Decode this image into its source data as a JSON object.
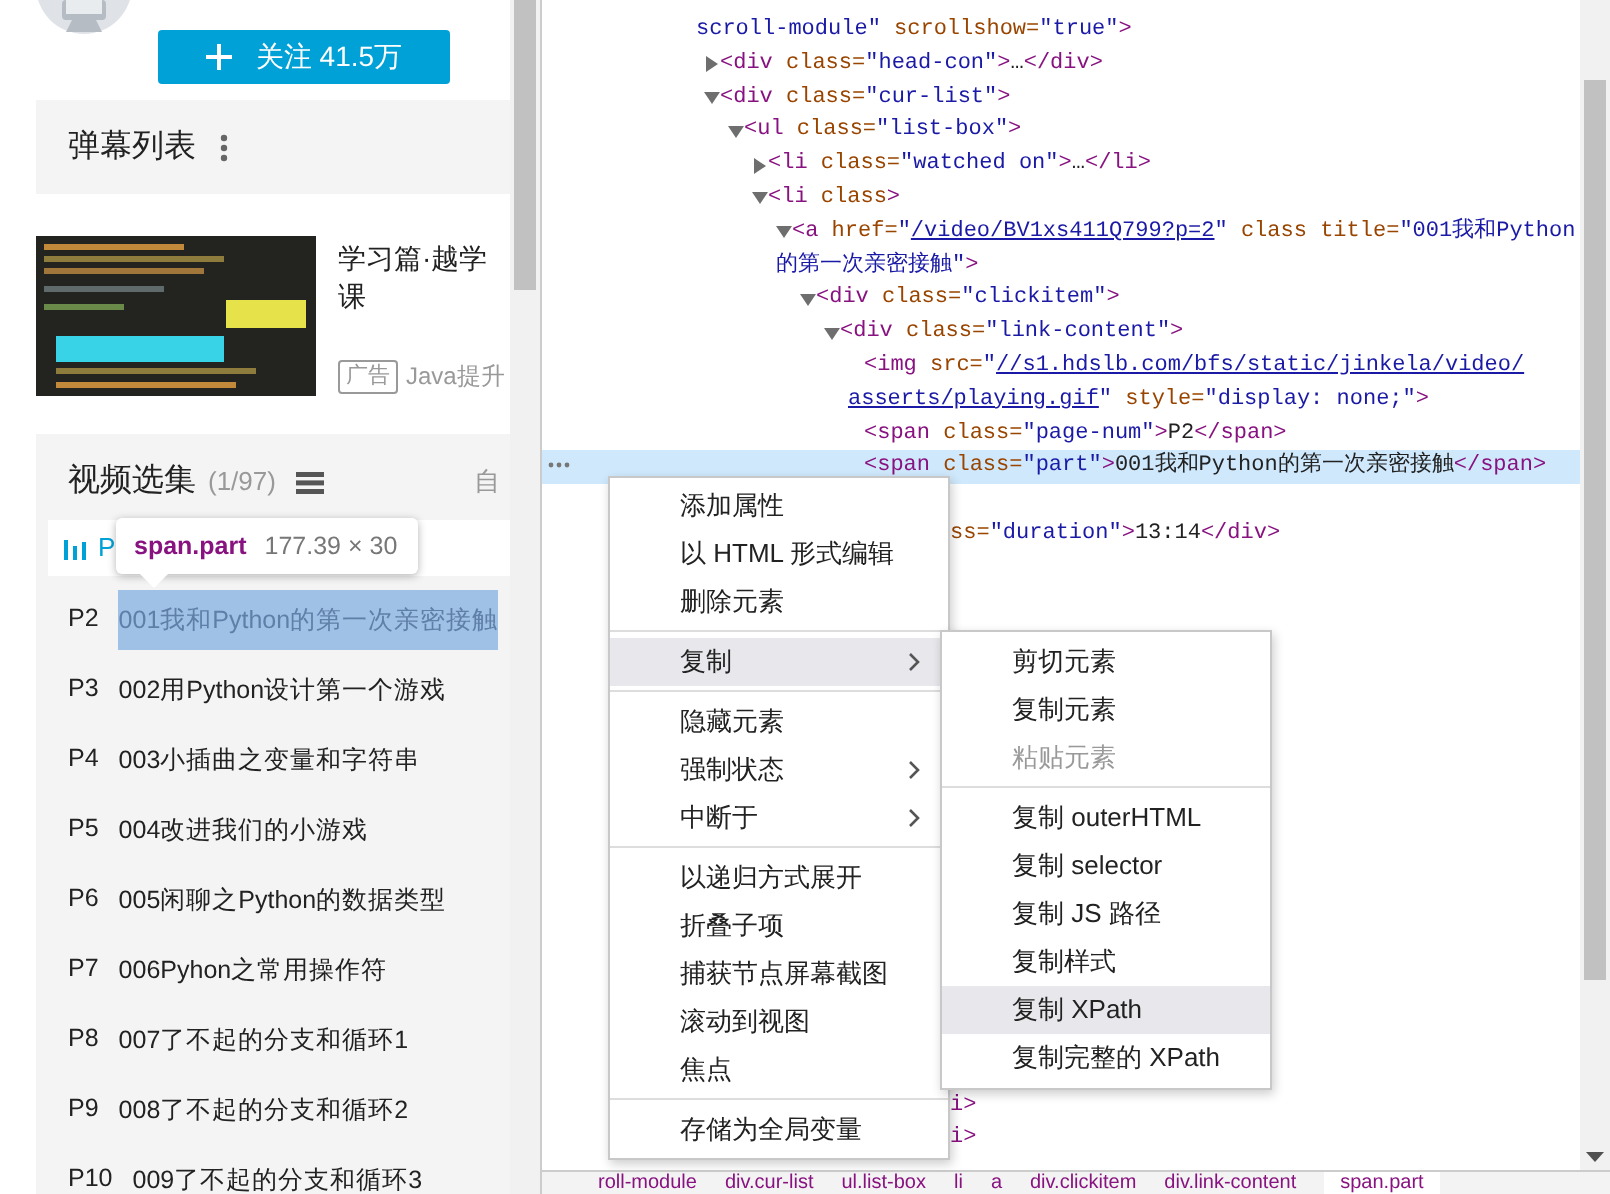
{
  "follow_button": {
    "label": "关注 41.5万"
  },
  "danmaku_section": {
    "title": "弹幕列表"
  },
  "ad": {
    "kind": "picture",
    "title_lines": [
      "学习篇·越学",
      "课"
    ],
    "tag": "广告",
    "source": "Java提升"
  },
  "episodes": {
    "title": "视频选集",
    "count": "(1/97)",
    "autoplay": "自",
    "current": {
      "label": "P",
      "playing": true
    },
    "items": [
      {
        "label": "P2",
        "title": "001我和Python的第一次亲密接触",
        "highlighted": true
      },
      {
        "label": "P3",
        "title": "002用Python设计第一个游戏",
        "highlighted": false
      },
      {
        "label": "P4",
        "title": "003小插曲之变量和字符串",
        "highlighted": false
      },
      {
        "label": "P5",
        "title": "004改进我们的小游戏",
        "highlighted": false
      },
      {
        "label": "P6",
        "title": "005闲聊之Python的数据类型",
        "highlighted": false
      },
      {
        "label": "P7",
        "title": "006Pyhon之常用操作符",
        "highlighted": false
      },
      {
        "label": "P8",
        "title": "007了不起的分支和循环1",
        "highlighted": false
      },
      {
        "label": "P9",
        "title": "008了不起的分支和循环2",
        "highlighted": false
      },
      {
        "label": "P10",
        "title": "009了不起的分支和循环3",
        "highlighted": false
      }
    ]
  },
  "inspect_tooltip": {
    "selector": "span.part",
    "size": "177.39 × 30"
  },
  "dom_tree": [
    {
      "selected": false,
      "lines": [
        [
          {
            "kind": "value",
            "text": "scroll-module\""
          },
          {
            "kind": "attr",
            "text": " scrollshow="
          },
          {
            "kind": "value",
            "text": "\"true\""
          },
          {
            "kind": "tag",
            "text": ">"
          }
        ]
      ],
      "children": [
        {
          "expanded": false,
          "selected": false,
          "lines": [
            [
              {
                "kind": "tag",
                "text": "<div"
              },
              {
                "kind": "attr",
                "text": " class="
              },
              {
                "kind": "value",
                "text": "\"head-con\""
              },
              {
                "kind": "tag",
                "text": ">"
              },
              {
                "kind": "text",
                "text": "…"
              },
              {
                "kind": "tag",
                "text": "</div>"
              }
            ]
          ]
        },
        {
          "expanded": true,
          "selected": false,
          "lines": [
            [
              {
                "kind": "tag",
                "text": "<div"
              },
              {
                "kind": "attr",
                "text": " class="
              },
              {
                "kind": "value",
                "text": "\"cur-list\""
              },
              {
                "kind": "tag",
                "text": ">"
              }
            ]
          ],
          "children": [
            {
              "expanded": true,
              "selected": false,
              "lines": [
                [
                  {
                    "kind": "tag",
                    "text": "<ul"
                  },
                  {
                    "kind": "attr",
                    "text": " class="
                  },
                  {
                    "kind": "value",
                    "text": "\"list-box\""
                  },
                  {
                    "kind": "tag",
                    "text": ">"
                  }
                ]
              ],
              "children": [
                {
                  "expanded": false,
                  "selected": false,
                  "lines": [
                    [
                      {
                        "kind": "tag",
                        "text": "<li"
                      },
                      {
                        "kind": "attr",
                        "text": " class="
                      },
                      {
                        "kind": "value",
                        "text": "\"watched on\""
                      },
                      {
                        "kind": "tag",
                        "text": ">"
                      },
                      {
                        "kind": "text",
                        "text": "…"
                      },
                      {
                        "kind": "tag",
                        "text": "</li>"
                      }
                    ]
                  ]
                },
                {
                  "expanded": true,
                  "selected": false,
                  "lines": [
                    [
                      {
                        "kind": "tag",
                        "text": "<li"
                      },
                      {
                        "kind": "attr",
                        "text": " class"
                      },
                      {
                        "kind": "tag",
                        "text": ">"
                      }
                    ]
                  ],
                  "children": [
                    {
                      "expanded": true,
                      "selected": false,
                      "lines": [
                        [
                          {
                            "kind": "tag",
                            "text": "<a"
                          },
                          {
                            "kind": "attr",
                            "text": " href="
                          },
                          {
                            "kind": "value",
                            "text": "\""
                          },
                          {
                            "kind": "link",
                            "text": "/video/BV1xs411Q799?p=2"
                          },
                          {
                            "kind": "value",
                            "text": "\""
                          },
                          {
                            "kind": "attr",
                            "text": " class title="
                          },
                          {
                            "kind": "value",
                            "text": "\"001我和Python"
                          }
                        ],
                        [
                          {
                            "kind": "value",
                            "text": "的第一次亲密接触\""
                          },
                          {
                            "kind": "tag",
                            "text": ">"
                          }
                        ]
                      ],
                      "children": [
                        {
                          "expanded": true,
                          "selected": false,
                          "lines": [
                            [
                              {
                                "kind": "tag",
                                "text": "<div"
                              },
                              {
                                "kind": "attr",
                                "text": " class="
                              },
                              {
                                "kind": "value",
                                "text": "\"clickitem\""
                              },
                              {
                                "kind": "tag",
                                "text": ">"
                              }
                            ]
                          ],
                          "children": [
                            {
                              "expanded": true,
                              "selected": false,
                              "lines": [
                                [
                                  {
                                    "kind": "tag",
                                    "text": "<div"
                                  },
                                  {
                                    "kind": "attr",
                                    "text": " class="
                                  },
                                  {
                                    "kind": "value",
                                    "text": "\"link-content\""
                                  },
                                  {
                                    "kind": "tag",
                                    "text": ">"
                                  }
                                ]
                              ],
                              "children": [
                                {
                                  "selected": false,
                                  "lines": [
                                    [
                                      {
                                        "kind": "tag",
                                        "text": "<img"
                                      },
                                      {
                                        "kind": "attr",
                                        "text": " src="
                                      },
                                      {
                                        "kind": "value",
                                        "text": "\""
                                      },
                                      {
                                        "kind": "link",
                                        "text": "//s1.hdslb.com/bfs/static/jinkela/video/"
                                      }
                                    ],
                                    [
                                      {
                                        "kind": "link",
                                        "text": "asserts/playing.gif"
                                      },
                                      {
                                        "kind": "value",
                                        "text": "\""
                                      },
                                      {
                                        "kind": "attr",
                                        "text": " style="
                                      },
                                      {
                                        "kind": "value",
                                        "text": "\"display: none;\""
                                      },
                                      {
                                        "kind": "tag",
                                        "text": ">"
                                      }
                                    ]
                                  ]
                                },
                                {
                                  "selected": false,
                                  "lines": [
                                    [
                                      {
                                        "kind": "tag",
                                        "text": "<span"
                                      },
                                      {
                                        "kind": "attr",
                                        "text": " class="
                                      },
                                      {
                                        "kind": "value",
                                        "text": "\"page-num\""
                                      },
                                      {
                                        "kind": "tag",
                                        "text": ">"
                                      },
                                      {
                                        "kind": "text",
                                        "text": "P2"
                                      },
                                      {
                                        "kind": "tag",
                                        "text": "</span>"
                                      }
                                    ]
                                  ]
                                },
                                {
                                  "selected": true,
                                  "lines": [
                                    [
                                      {
                                        "kind": "tag",
                                        "text": "<span"
                                      },
                                      {
                                        "kind": "attr",
                                        "text": " class="
                                      },
                                      {
                                        "kind": "value",
                                        "text": "\"part\""
                                      },
                                      {
                                        "kind": "tag",
                                        "text": ">"
                                      },
                                      {
                                        "kind": "text",
                                        "text": "001我和Python的第一次亲密接触"
                                      },
                                      {
                                        "kind": "tag",
                                        "text": "</span>"
                                      }
                                    ]
                                  ]
                                }
                              ]
                            }
                          ]
                        }
                      ]
                    }
                  ]
                }
              ]
            }
          ]
        }
      ]
    }
  ],
  "covered_lines": [
    [
      {
        "kind": "attr",
        "text": "ss="
      },
      {
        "kind": "value",
        "text": "\"duration\""
      },
      {
        "kind": "tag",
        "text": ">"
      },
      {
        "kind": "text",
        "text": "13:14"
      },
      {
        "kind": "tag",
        "text": "</div>"
      }
    ],
    [
      {
        "kind": "tag",
        "text": "i>"
      }
    ],
    [
      {
        "kind": "tag",
        "text": "i>"
      }
    ]
  ],
  "context_menu": {
    "items": [
      {
        "kind": "item",
        "label": "添加属性",
        "highlighted": false,
        "has_submenu": false
      },
      {
        "kind": "item",
        "label": "以 HTML 形式编辑",
        "highlighted": false,
        "has_submenu": false
      },
      {
        "kind": "item",
        "label": "删除元素",
        "highlighted": false,
        "has_submenu": false
      },
      {
        "kind": "separator"
      },
      {
        "kind": "item",
        "label": "复制",
        "highlighted": true,
        "has_submenu": true
      },
      {
        "kind": "separator"
      },
      {
        "kind": "item",
        "label": "隐藏元素",
        "highlighted": false,
        "has_submenu": false
      },
      {
        "kind": "item",
        "label": "强制状态",
        "highlighted": false,
        "has_submenu": true
      },
      {
        "kind": "item",
        "label": "中断于",
        "highlighted": false,
        "has_submenu": true
      },
      {
        "kind": "separator"
      },
      {
        "kind": "item",
        "label": "以递归方式展开",
        "highlighted": false,
        "has_submenu": false
      },
      {
        "kind": "item",
        "label": "折叠子项",
        "highlighted": false,
        "has_submenu": false
      },
      {
        "kind": "item",
        "label": "捕获节点屏幕截图",
        "highlighted": false,
        "has_submenu": false
      },
      {
        "kind": "item",
        "label": "滚动到视图",
        "highlighted": false,
        "has_submenu": false
      },
      {
        "kind": "item",
        "label": "焦点",
        "highlighted": false,
        "has_submenu": false
      },
      {
        "kind": "separator"
      },
      {
        "kind": "item",
        "label": "存储为全局变量",
        "highlighted": false,
        "has_submenu": false
      }
    ]
  },
  "submenu": {
    "items": [
      {
        "kind": "item",
        "label": "剪切元素",
        "highlighted": false,
        "disabled": false
      },
      {
        "kind": "item",
        "label": "复制元素",
        "highlighted": false,
        "disabled": false
      },
      {
        "kind": "item",
        "label": "粘贴元素",
        "highlighted": false,
        "disabled": true
      },
      {
        "kind": "separator"
      },
      {
        "kind": "item",
        "label": "复制 outerHTML",
        "highlighted": false,
        "disabled": false
      },
      {
        "kind": "item",
        "label": "复制 selector",
        "highlighted": false,
        "disabled": false
      },
      {
        "kind": "item",
        "label": "复制 JS 路径",
        "highlighted": false,
        "disabled": false
      },
      {
        "kind": "item",
        "label": "复制样式",
        "highlighted": false,
        "disabled": false
      },
      {
        "kind": "item",
        "label": "复制 XPath",
        "highlighted": true,
        "disabled": false
      },
      {
        "kind": "item",
        "label": "复制完整的 XPath",
        "highlighted": false,
        "disabled": false
      }
    ]
  },
  "breadcrumbs": [
    {
      "label": "roll-module",
      "selected": false
    },
    {
      "label": "div.cur-list",
      "selected": false
    },
    {
      "label": "ul.list-box",
      "selected": false
    },
    {
      "label": "li",
      "selected": false
    },
    {
      "label": "a",
      "selected": false
    },
    {
      "label": "div.clickitem",
      "selected": false
    },
    {
      "label": "div.link-content",
      "selected": false
    },
    {
      "label": "span.part",
      "selected": true
    }
  ]
}
